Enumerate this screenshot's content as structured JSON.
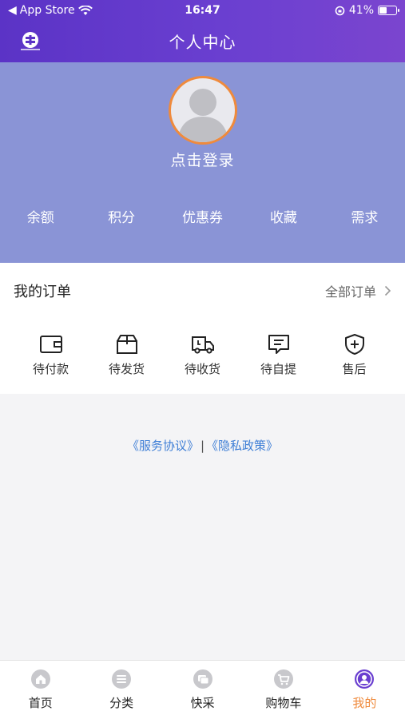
{
  "status_bar": {
    "back_app": "App Store",
    "time": "16:47",
    "battery": "41%",
    "battery_level": 0.41
  },
  "header": {
    "title": "个人中心"
  },
  "profile": {
    "login_text": "点击登录",
    "stats": [
      "余额",
      "积分",
      "优惠券",
      "收藏",
      "需求"
    ]
  },
  "orders": {
    "title": "我的订单",
    "all_label": "全部订单",
    "items": [
      {
        "label": "待付款",
        "icon": "wallet-icon"
      },
      {
        "label": "待发货",
        "icon": "package-icon"
      },
      {
        "label": "待收货",
        "icon": "delivery-truck-icon"
      },
      {
        "label": "待自提",
        "icon": "message-icon"
      },
      {
        "label": "售后",
        "icon": "shield-plus-icon"
      }
    ]
  },
  "links": {
    "service": "《服务协议》",
    "separator": "|",
    "privacy": "《隐私政策》"
  },
  "tabbar": {
    "items": [
      {
        "label": "首页",
        "icon": "home-icon"
      },
      {
        "label": "分类",
        "icon": "category-icon"
      },
      {
        "label": "快采",
        "icon": "quick-buy-icon"
      },
      {
        "label": "购物车",
        "icon": "cart-icon"
      },
      {
        "label": "我的",
        "icon": "user-icon"
      }
    ],
    "active_index": 4
  },
  "colors": {
    "header": "#6a3fd0",
    "profile_bg": "#8a94d6",
    "accent": "#ef8a3c",
    "link": "#3f7fd6"
  }
}
